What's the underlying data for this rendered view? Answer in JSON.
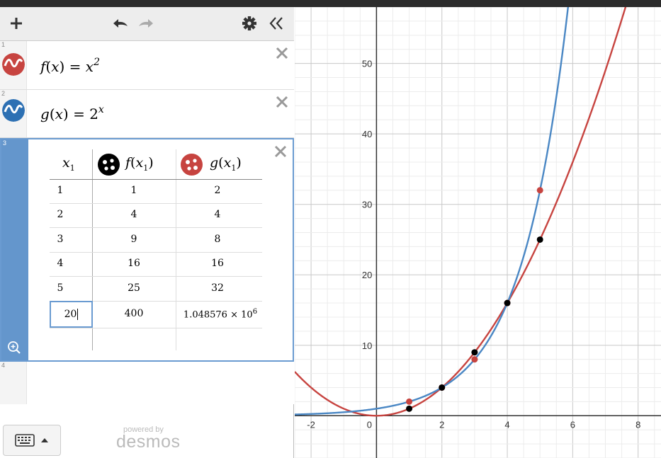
{
  "toolbar": {
    "add_icon": "plus-icon",
    "undo_icon": "undo-icon",
    "redo_icon": "redo-icon",
    "settings_icon": "gear-icon",
    "collapse_icon": "double-chevron-left-icon"
  },
  "expressions": [
    {
      "num": "1",
      "color": "#c74440",
      "fn": "f",
      "arg": "x",
      "rhs_base": "x",
      "rhs_exp": "2"
    },
    {
      "num": "2",
      "color": "#2d70b3",
      "fn": "g",
      "arg": "x",
      "rhs_base": "2",
      "rhs_exp": "x"
    }
  ],
  "table": {
    "num": "3",
    "headers": [
      {
        "var": "x",
        "sub": "1"
      },
      {
        "fn": "f",
        "var": "x",
        "sub": "1",
        "point_color": "#000000"
      },
      {
        "fn": "g",
        "var": "x",
        "sub": "1",
        "point_color": "#c74440"
      }
    ],
    "rows": [
      [
        "1",
        "1",
        "2"
      ],
      [
        "2",
        "4",
        "4"
      ],
      [
        "3",
        "9",
        "8"
      ],
      [
        "4",
        "16",
        "16"
      ],
      [
        "5",
        "25",
        "32"
      ]
    ],
    "edit_row": {
      "input": "20",
      "f": "400",
      "g_mantissa": "1.048576",
      "g_times": "×",
      "g_base": "10",
      "g_exp": "6"
    },
    "zoom_icon": "zoom-fit-icon"
  },
  "empty_row_num": "4",
  "footer": {
    "keyboard_icon": "keyboard-icon",
    "powered_by": "powered by",
    "brand": "desmos"
  },
  "graph": {
    "x_ticks": [
      "-2",
      "0",
      "2",
      "4",
      "6",
      "8"
    ],
    "y_ticks": [
      "10",
      "20",
      "30",
      "40",
      "50"
    ],
    "colors": {
      "f": "#c74440",
      "g": "#4a87c4",
      "table_f_points": "#000000",
      "table_g_points": "#c74440"
    }
  },
  "chart_data": {
    "type": "line",
    "xlim": [
      -2.5,
      8.7
    ],
    "ylim": [
      -6,
      58
    ],
    "x_ticks": [
      "-2",
      "0",
      "2",
      "4",
      "6",
      "8"
    ],
    "y_ticks": [
      "10",
      "20",
      "30",
      "40",
      "50"
    ],
    "grid": true,
    "series": [
      {
        "name": "f(x) = x^2",
        "kind": "curve",
        "color": "#c74440"
      },
      {
        "name": "g(x) = 2^x",
        "kind": "curve",
        "color": "#4a87c4"
      },
      {
        "name": "f(x_1)",
        "kind": "points",
        "color": "#000000",
        "x": [
          1,
          2,
          3,
          4,
          5
        ],
        "y": [
          1,
          4,
          9,
          16,
          25
        ]
      },
      {
        "name": "g(x_1)",
        "kind": "points",
        "color": "#c74440",
        "x": [
          1,
          2,
          3,
          4,
          5
        ],
        "y": [
          2,
          4,
          8,
          16,
          32
        ]
      }
    ]
  }
}
